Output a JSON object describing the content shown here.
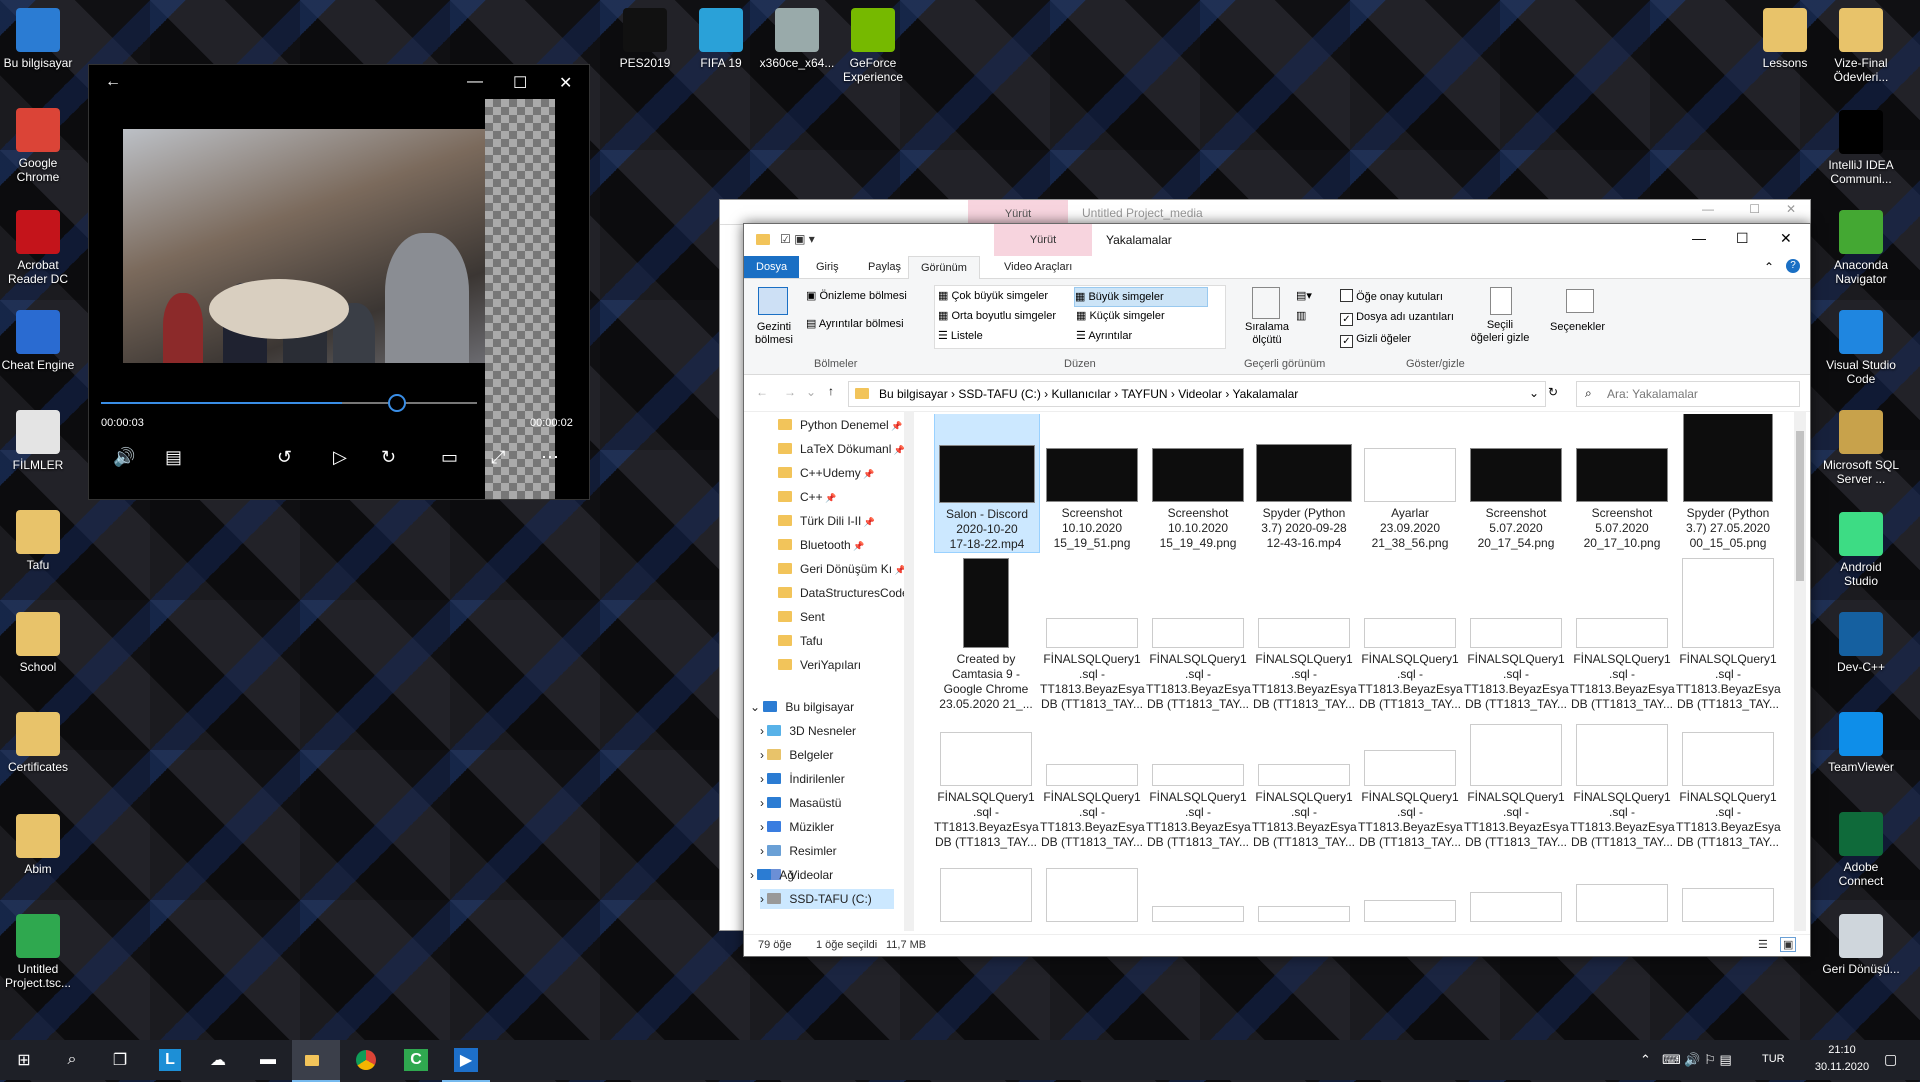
{
  "desktop_icons_left": [
    {
      "label": "Bu bilgisayar",
      "icon": "computer-icon"
    },
    {
      "label": "Google Chrome",
      "icon": "chrome-icon"
    },
    {
      "label": "Acrobat Reader DC",
      "icon": "acrobat-icon"
    },
    {
      "label": "Cheat Engine",
      "icon": "cheat-engine-icon"
    },
    {
      "label": "FİLMLER",
      "icon": "shortcut-icon"
    },
    {
      "label": "Tafu",
      "icon": "folder-icon"
    },
    {
      "label": "School",
      "icon": "folder-icon"
    },
    {
      "label": "Certificates",
      "icon": "folder-icon"
    },
    {
      "label": "Abim",
      "icon": "folder-icon"
    },
    {
      "label": "Untitled Project.tsc...",
      "icon": "camtasia-project-icon"
    }
  ],
  "desktop_icons_top": [
    {
      "label": "PES2019",
      "icon": "pes-icon"
    },
    {
      "label": "FIFA 19",
      "icon": "fifa-icon"
    },
    {
      "label": "x360ce_x64...",
      "icon": "gamepad-icon"
    },
    {
      "label": "GeForce Experience",
      "icon": "nvidia-icon"
    }
  ],
  "desktop_icons_right": [
    {
      "label": "Lessons",
      "icon": "folder-icon"
    },
    {
      "label": "Vize-Final Ödevleri...",
      "icon": "folder-icon"
    },
    {
      "label": "IntelliJ IDEA Communi...",
      "icon": "intellij-icon"
    },
    {
      "label": "Anaconda Navigator",
      "icon": "anaconda-icon"
    },
    {
      "label": "Visual Studio Code",
      "icon": "vscode-icon"
    },
    {
      "label": "Microsoft SQL Server ...",
      "icon": "sqlserver-icon"
    },
    {
      "label": "Android Studio",
      "icon": "android-studio-icon"
    },
    {
      "label": "Dev-C++",
      "icon": "devcpp-icon"
    },
    {
      "label": "TeamViewer",
      "icon": "teamviewer-icon"
    },
    {
      "label": "Adobe Connect",
      "icon": "adobe-connect-icon"
    },
    {
      "label": "Geri Dönüşü...",
      "icon": "recycle-bin-icon"
    }
  ],
  "player": {
    "time_current": "00:00:03",
    "time_remaining": "00:00:02",
    "progress": 0.64
  },
  "back_window": {
    "tool_tab": "Yürüt",
    "title": "Untitled Project_media"
  },
  "explorer": {
    "title": "Yakalamalar",
    "tool_tab": "Yürüt",
    "tabs": [
      "Dosya",
      "Giriş",
      "Paylaş",
      "Görünüm",
      "Video Araçları"
    ],
    "ribbon": {
      "panes": {
        "nav_pane": "Gezinti bölmesi",
        "preview": "Önizleme bölmesi",
        "details": "Ayrıntılar bölmesi",
        "group": "Bölmeler"
      },
      "layout": {
        "options": [
          "Çok büyük simgeler",
          "Büyük simgeler",
          "Orta boyutlu simgeler",
          "Küçük simgeler",
          "Listele",
          "Ayrıntılar"
        ],
        "selected": "Büyük simgeler",
        "group": "Düzen"
      },
      "current_view": {
        "sort": "Sıralama ölçütü",
        "group": "Geçerli görünüm"
      },
      "show_hide": {
        "item_checkboxes": "Öğe onay kutuları",
        "file_extensions": "Dosya adı uzantıları",
        "hidden_items": "Gizli öğeler",
        "hide_selected": "Seçili öğeleri gizle",
        "group": "Göster/gizle",
        "checked": [
          false,
          true,
          true
        ]
      },
      "options": "Seçenekler"
    },
    "address": [
      "Bu bilgisayar",
      "SSD-TAFU (C:)",
      "Kullanıcılar",
      "TAYFUN",
      "Videolar",
      "Yakalamalar"
    ],
    "search_placeholder": "Ara: Yakalamalar",
    "quick_access": [
      "Python Denemel",
      "LaTeX Dökumanl",
      "C++Udemy",
      "C++",
      "Türk Dili I-II",
      "Bluetooth",
      "Geri Dönüşüm Kı",
      "DataStructuresCode",
      "Sent",
      "Tafu",
      "VeriYapıları"
    ],
    "this_pc": "Bu bilgisayar",
    "this_pc_items": [
      "3D Nesneler",
      "Belgeler",
      "İndirilenler",
      "Masaüstü",
      "Müzikler",
      "Resimler",
      "Videolar",
      "SSD-TAFU (C:)"
    ],
    "network": "Ağ",
    "files_row1": [
      [
        "Salon - Discord",
        "2020-10-20",
        "17-18-22.mp4"
      ],
      [
        "Screenshot",
        "10.10.2020",
        "15_19_51.png"
      ],
      [
        "Screenshot",
        "10.10.2020",
        "15_19_49.png"
      ],
      [
        "Spyder (Python",
        "3.7) 2020-09-28",
        "12-43-16.mp4"
      ],
      [
        "Ayarlar",
        "23.09.2020",
        "21_38_56.png"
      ],
      [
        "Screenshot",
        "5.07.2020",
        "20_17_54.png"
      ],
      [
        "Screenshot",
        "5.07.2020",
        "20_17_10.png"
      ],
      [
        "Spyder (Python",
        "3.7) 27.05.2020",
        "00_15_05.png"
      ]
    ],
    "file_camtasia": [
      "Created by",
      "Camtasia 9 -",
      "Google Chrome",
      "23.05.2020 21_..."
    ],
    "sql_label": [
      "FİNALSQLQuery1",
      ".sql -",
      "TT1813.BeyazEsya",
      "DB (TT1813_TAY..."
    ],
    "status": {
      "count": "79 öğe",
      "selected": "1 öğe seçildi",
      "size": "11,7 MB"
    }
  },
  "taskbar": {
    "lang": "TUR",
    "time": "21:10",
    "date": "30.11.2020"
  }
}
